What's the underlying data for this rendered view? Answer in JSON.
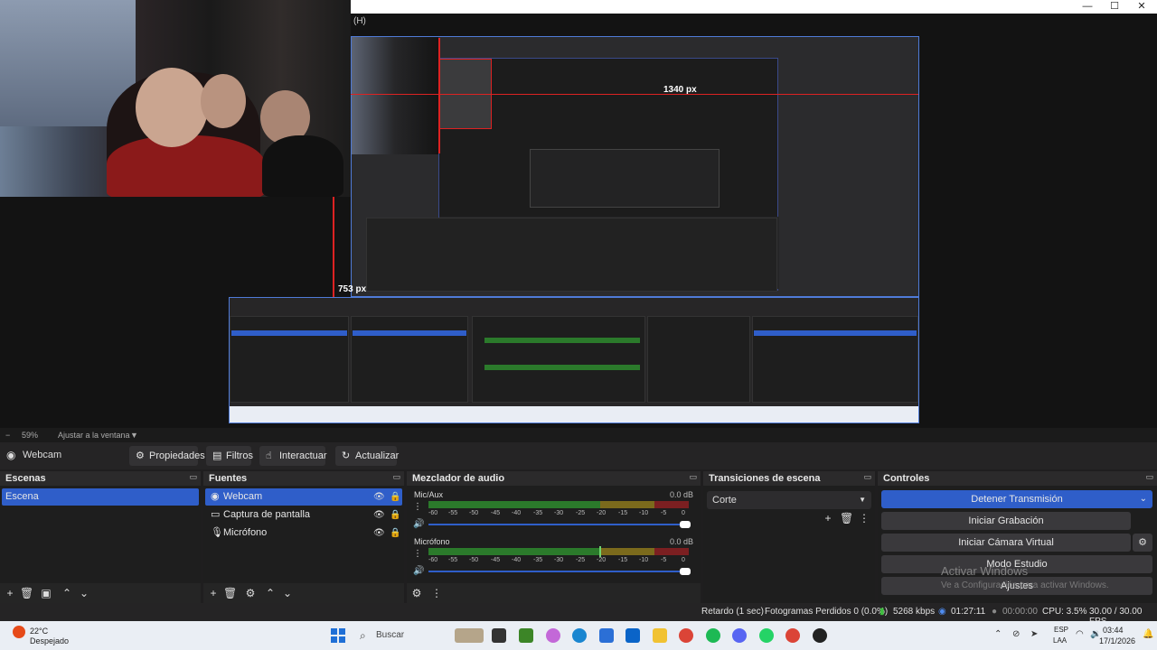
{
  "window": {
    "controls": [
      "—",
      "☐",
      "✕"
    ]
  },
  "preview": {
    "scene_label": "(H)",
    "labels": {
      "width": "1340 px",
      "height": "753 px"
    }
  },
  "zoom": {
    "minus": "−",
    "value": "59%",
    "fit": "Ajustar a la ventana",
    "caret": "▼"
  },
  "toolbar": {
    "source_name": "Webcam",
    "buttons": [
      {
        "label": "Propiedades",
        "icon": "gear-icon"
      },
      {
        "label": "Filtros",
        "icon": "filters-icon"
      },
      {
        "label": "Interactuar",
        "icon": "interact-icon"
      },
      {
        "label": "Actualizar",
        "icon": "refresh-icon"
      }
    ]
  },
  "scenes": {
    "title": "Escenas",
    "items": [
      "Escena"
    ]
  },
  "sources": {
    "title": "Fuentes",
    "items": [
      {
        "label": "Webcam",
        "icon": "webcam-icon"
      },
      {
        "label": "Captura de pantalla",
        "icon": "monitor-icon"
      },
      {
        "label": "Micrófono",
        "icon": "microphone-icon"
      }
    ]
  },
  "mixer": {
    "title": "Mezclador de audio",
    "ticks": [
      "-60",
      "-55",
      "-50",
      "-45",
      "-40",
      "-35",
      "-30",
      "-25",
      "-20",
      "-15",
      "-10",
      "-5",
      "0"
    ],
    "channels": [
      {
        "name": "Mic/Aux",
        "db": "0.0 dB",
        "level": 0.0
      },
      {
        "name": "Micrófono",
        "db": "0.0 dB",
        "level": 0.65
      }
    ]
  },
  "transitions": {
    "title": "Transiciones de escena",
    "selected": "Corte"
  },
  "controls": {
    "title": "Controles",
    "stop_stream": "Detener Transmisión",
    "start_recording": "Iniciar Grabación",
    "start_virtual_cam": "Iniciar Cámara Virtual",
    "studio_mode": "Modo Estudio",
    "settings": "Ajustes"
  },
  "watermark": {
    "line1": "Activar Windows",
    "line2": "Ve a Configuración para activar Windows."
  },
  "status": {
    "delay": "Retardo (1 sec)",
    "dropped": "Fotogramas Perdidos 0 (0.0%)",
    "bitrate": "5268 kbps",
    "stream_time": "01:27:11",
    "rec_time": "00:00:00",
    "cpu": "CPU: 3.5%",
    "fps": "30.00 / 30.00 FPS"
  },
  "taskbar": {
    "temperature": "22°C",
    "weather": "Despejado",
    "search_placeholder": "Buscar",
    "lang_line1": "ESP",
    "lang_line2": "LAA",
    "time": "03:44",
    "date": "17/1/2026"
  },
  "colors": {
    "accent": "#2f5ec9",
    "panel": "#252525",
    "panel_dark": "#1e1e1e"
  }
}
